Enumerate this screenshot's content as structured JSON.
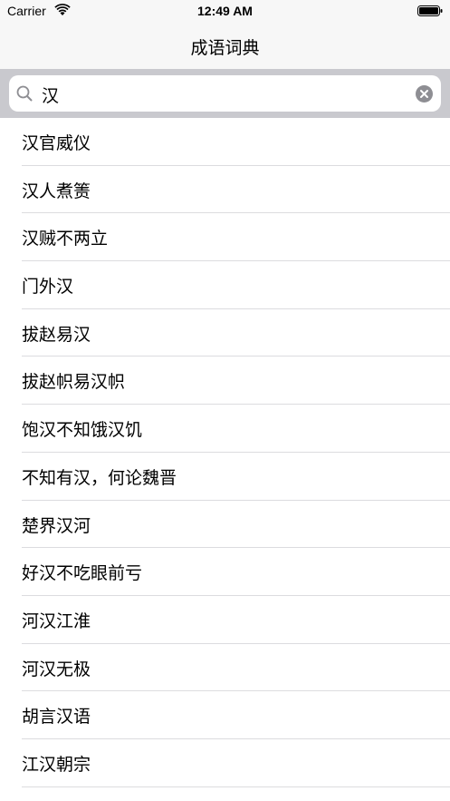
{
  "status_bar": {
    "carrier": "Carrier",
    "time": "12:49 AM"
  },
  "nav": {
    "title": "成语词典"
  },
  "search": {
    "value": "汉",
    "icon": "search-icon",
    "clear_icon": "clear-icon"
  },
  "results": [
    {
      "label": "汉官威仪"
    },
    {
      "label": "汉人煮箦"
    },
    {
      "label": "汉贼不两立"
    },
    {
      "label": "门外汉"
    },
    {
      "label": "拔赵易汉"
    },
    {
      "label": "拔赵帜易汉帜"
    },
    {
      "label": "饱汉不知饿汉饥"
    },
    {
      "label": "不知有汉，何论魏晋"
    },
    {
      "label": "楚界汉河"
    },
    {
      "label": "好汉不吃眼前亏"
    },
    {
      "label": "河汉江淮"
    },
    {
      "label": "河汉无极"
    },
    {
      "label": "胡言汉语"
    },
    {
      "label": "江汉朝宗"
    }
  ]
}
